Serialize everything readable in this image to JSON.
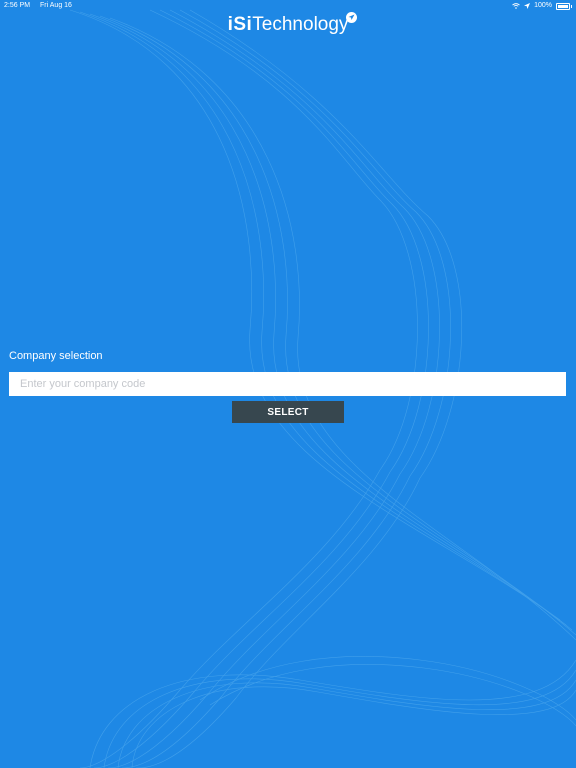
{
  "status_bar": {
    "time": "2:56 PM",
    "date": "Fri Aug 16",
    "battery": "100%",
    "wifi_icon": "wifi-icon",
    "location_icon": "location-arrow-icon",
    "battery_icon": "battery-icon"
  },
  "brand": {
    "isi": "iSi",
    "technology": "Technology",
    "badge_icon": "paper-plane-icon"
  },
  "form": {
    "label": "Company selection",
    "input_value": "",
    "input_placeholder": "Enter your company code",
    "select_label": "SELECT"
  },
  "colors": {
    "background": "#1e88e5",
    "button": "#37474f",
    "input_bg": "#ffffff"
  }
}
